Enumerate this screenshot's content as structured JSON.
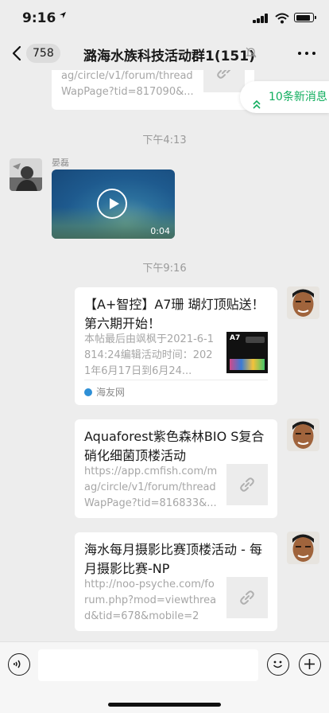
{
  "status_bar": {
    "time": "9:16"
  },
  "nav": {
    "unread_count": "758",
    "title": "潞海水族科技活动群1(151)"
  },
  "new_messages": {
    "label": "10条新消息"
  },
  "messages": {
    "top_link": {
      "lines": [
        "ag/circle/v1/forum/thread",
        "WapPage?tid=817090&..."
      ]
    },
    "time_1": "下午4:13",
    "sender_1": "晏磊",
    "video_duration": "0:04",
    "time_2": "下午9:16",
    "card_1": {
      "title": "【A+智控】A7珊 瑚灯顶贴送！ 第六期开始！",
      "desc": "本帖最后由飒枫于2021-6-1814:24编辑活动时间：2021年6月17日到6月24...",
      "thumb_label": "A7",
      "source": "海友网"
    },
    "card_2": {
      "title": "Aquaforest紫色森林BIO S复合硝化细菌顶楼活动",
      "desc": "https://app.cmfish.com/mag/circle/v1/forum/threadWapPage?tid=816833&..."
    },
    "card_3": {
      "title": "海水每月摄影比赛顶楼活动 - 每月摄影比赛-NP",
      "desc": "http://noo-psyche.com/forum.php?mod=viewthread&tid=678&mobile=2"
    }
  },
  "colors": {
    "accent": "#10ae5e",
    "background": "#ededed",
    "bubble": "#ffffff"
  }
}
